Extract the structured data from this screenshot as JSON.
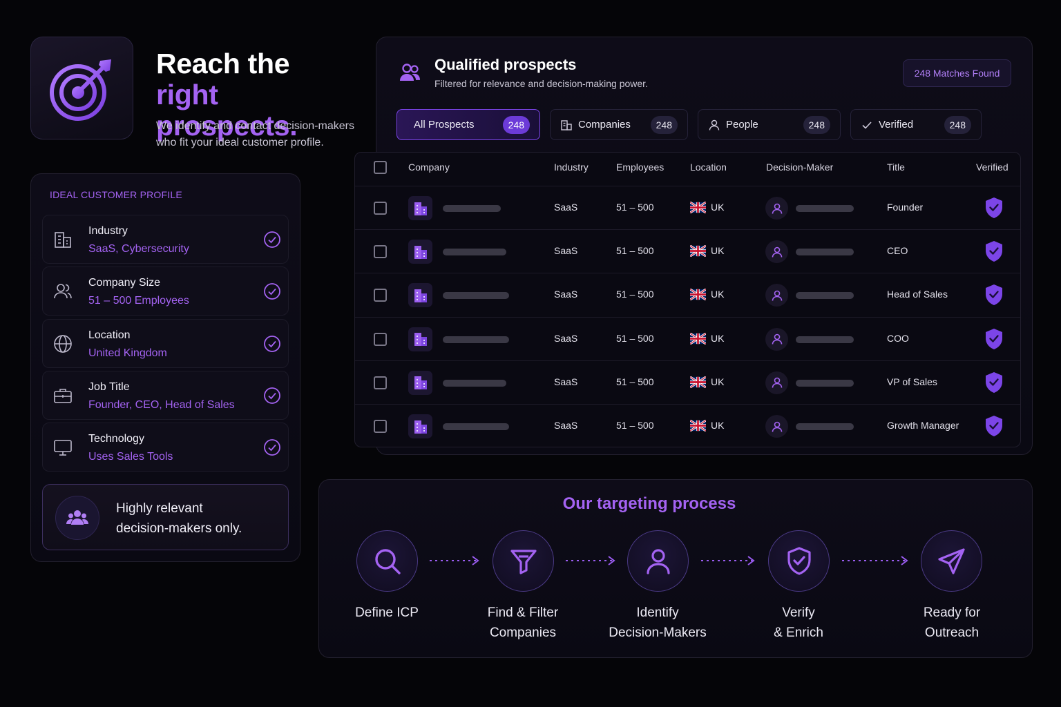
{
  "hero": {
    "title_line1": "Reach the",
    "title_line2": "right prospects.",
    "subtitle_line1": "We identify and contact decision-makers",
    "subtitle_line2": "who fit your ideal customer profile."
  },
  "icp": {
    "title": "IDEAL CUSTOMER PROFILE",
    "items": [
      {
        "label": "Industry",
        "value": "SaaS, Cybersecurity",
        "icon": "building-icon"
      },
      {
        "label": "Company Size",
        "value": "51 – 500 Employees",
        "icon": "users-icon"
      },
      {
        "label": "Location",
        "value": "United Kingdom",
        "icon": "globe-icon"
      },
      {
        "label": "Job Title",
        "value": "Founder, CEO, Head of Sales",
        "icon": "briefcase-icon"
      },
      {
        "label": "Technology",
        "value": "Uses Sales Tools",
        "icon": "monitor-icon"
      }
    ],
    "highlight_line1": "Highly relevant",
    "highlight_line2": "decision-makers only."
  },
  "prospects": {
    "title": "Qualified prospects",
    "subtitle": "Filtered for relevance and decision-making power.",
    "matches_badge": "248 Matches Found",
    "tabs": [
      {
        "label": "All Prospects",
        "count": "248",
        "active": true
      },
      {
        "label": "Companies",
        "count": "248",
        "active": false
      },
      {
        "label": "People",
        "count": "248",
        "active": false
      },
      {
        "label": "Verified",
        "count": "248",
        "active": false
      }
    ],
    "columns": [
      "Company",
      "Industry",
      "Employees",
      "Location",
      "Decision-Maker",
      "Title",
      "Verified"
    ],
    "rows": [
      {
        "industry": "SaaS",
        "employees": "51 – 500",
        "location": "UK",
        "title": "Founder",
        "verified": true
      },
      {
        "industry": "SaaS",
        "employees": "51 – 500",
        "location": "UK",
        "title": "CEO",
        "verified": true
      },
      {
        "industry": "SaaS",
        "employees": "51 – 500",
        "location": "UK",
        "title": "Head of Sales",
        "verified": true
      },
      {
        "industry": "SaaS",
        "employees": "51 – 500",
        "location": "UK",
        "title": "COO",
        "verified": true
      },
      {
        "industry": "SaaS",
        "employees": "51 – 500",
        "location": "UK",
        "title": "VP of Sales",
        "verified": true
      },
      {
        "industry": "SaaS",
        "employees": "51 – 500",
        "location": "UK",
        "title": "Growth Manager",
        "verified": true
      }
    ]
  },
  "process": {
    "title": "Our targeting process",
    "steps": [
      {
        "line1": "Define ICP",
        "line2": "",
        "icon": "search-icon"
      },
      {
        "line1": "Find & Filter",
        "line2": "Companies",
        "icon": "filter-icon"
      },
      {
        "line1": "Identify",
        "line2": "Decision-Makers",
        "icon": "person-icon"
      },
      {
        "line1": "Verify",
        "line2": "& Enrich",
        "icon": "shield-check-icon"
      },
      {
        "line1": "Ready for",
        "line2": "Outreach",
        "icon": "send-icon"
      }
    ]
  },
  "colors": {
    "background": "#050508",
    "accent": "#A463F2",
    "accent_strong": "#7C45E8",
    "card": "#0e0c18"
  }
}
